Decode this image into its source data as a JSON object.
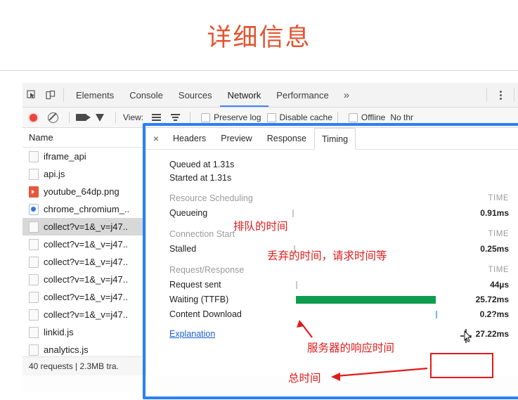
{
  "slide": {
    "title": "详细信息",
    "title_color": "#e2532f"
  },
  "devtools": {
    "left_icons": [
      {
        "name": "inspect-element-icon"
      },
      {
        "name": "device-toolbar-icon"
      }
    ],
    "tabs": [
      {
        "label": "Elements",
        "active": false
      },
      {
        "label": "Console",
        "active": false
      },
      {
        "label": "Sources",
        "active": false
      },
      {
        "label": "Network",
        "active": true
      },
      {
        "label": "Performance",
        "active": false
      }
    ],
    "more_tabs": "»",
    "kebab": "more-options",
    "options_bar": {
      "record_label": "record-button",
      "clear_label": "clear-button",
      "capture_screenshots_label": "capture-screenshots-button",
      "filter_label": "filter-button",
      "view_label": "View:",
      "checkboxes": [
        {
          "label": "Preserve log",
          "checked": false
        },
        {
          "label": "Disable cache",
          "checked": false
        },
        {
          "label": "Offline",
          "checked": false
        }
      ],
      "throttling": "No thr"
    },
    "requests_panel": {
      "column_header": "Name",
      "rows": [
        {
          "name": "iframe_api",
          "icon": "generic-file-icon",
          "selected": false
        },
        {
          "name": "api.js",
          "icon": "generic-file-icon",
          "selected": false
        },
        {
          "name": "youtube_64dp.png",
          "icon": "image-file-icon",
          "selected": false
        },
        {
          "name": "chrome_chromium_..",
          "icon": "document-file-icon",
          "selected": false
        },
        {
          "name": "collect?v=1&_v=j47..",
          "icon": "generic-file-icon",
          "selected": true
        },
        {
          "name": "collect?v=1&_v=j47..",
          "icon": "generic-file-icon",
          "selected": false
        },
        {
          "name": "collect?v=1&_v=j47..",
          "icon": "generic-file-icon",
          "selected": false
        },
        {
          "name": "collect?v=1&_v=j47..",
          "icon": "generic-file-icon",
          "selected": false
        },
        {
          "name": "collect?v=1&_v=j47..",
          "icon": "generic-file-icon",
          "selected": false
        },
        {
          "name": "collect?v=1&_v=j47..",
          "icon": "generic-file-icon",
          "selected": false
        },
        {
          "name": "linkid.js",
          "icon": "generic-file-icon",
          "selected": false
        },
        {
          "name": "analytics.js",
          "icon": "generic-file-icon",
          "selected": false
        }
      ],
      "status": "40 requests | 2.3MB tra."
    },
    "detail_panel": {
      "close_label": "×",
      "tabs": [
        {
          "label": "Headers",
          "active": false
        },
        {
          "label": "Preview",
          "active": false
        },
        {
          "label": "Response",
          "active": false
        },
        {
          "label": "Timing",
          "active": true
        }
      ],
      "timing": {
        "queued_at": "Queued at 1.31s",
        "started_at": "Started at 1.31s",
        "time_column_header": "TIME",
        "groups": [
          {
            "group": "Resource Scheduling",
            "rows": [
              {
                "label": "Queueing",
                "time": "0.91ms",
                "bar": "thin",
                "bar_left_pct": 2,
                "bar_width_pct": 1
              }
            ]
          },
          {
            "group": "Connection Start",
            "rows": [
              {
                "label": "Stalled",
                "time": "0.25ms",
                "bar": "thin",
                "bar_left_pct": 3,
                "bar_width_pct": 1
              }
            ]
          },
          {
            "group": "Request/Response",
            "rows": [
              {
                "label": "Request sent",
                "time": "44µs",
                "bar": "thin",
                "bar_left_pct": 4,
                "bar_width_pct": 1
              },
              {
                "label": "Waiting (TTFB)",
                "time": "25.72ms",
                "bar": "green",
                "bar_left_pct": 4,
                "bar_width_pct": 82
              },
              {
                "label": "Content Download",
                "time": "0.2?ms",
                "bar": "blue",
                "bar_left_pct": 86,
                "bar_width_pct": 1
              }
            ]
          }
        ],
        "explanation_link": "Explanation",
        "total_time": "27.22ms"
      }
    }
  },
  "annotations": [
    {
      "name": "queueing-note",
      "text": "排队的时间",
      "color": "#e01b1b"
    },
    {
      "name": "stalled-note",
      "text": "丢弃的时间，请求时间等",
      "color": "#e01b1b"
    },
    {
      "name": "server-response-note",
      "text": "服务器的响应时间",
      "color": "#e01b1b"
    },
    {
      "name": "total-time-note",
      "text": "总时间",
      "color": "#e01b1b"
    }
  ],
  "highlight": {
    "color": "#2b7ff5"
  }
}
